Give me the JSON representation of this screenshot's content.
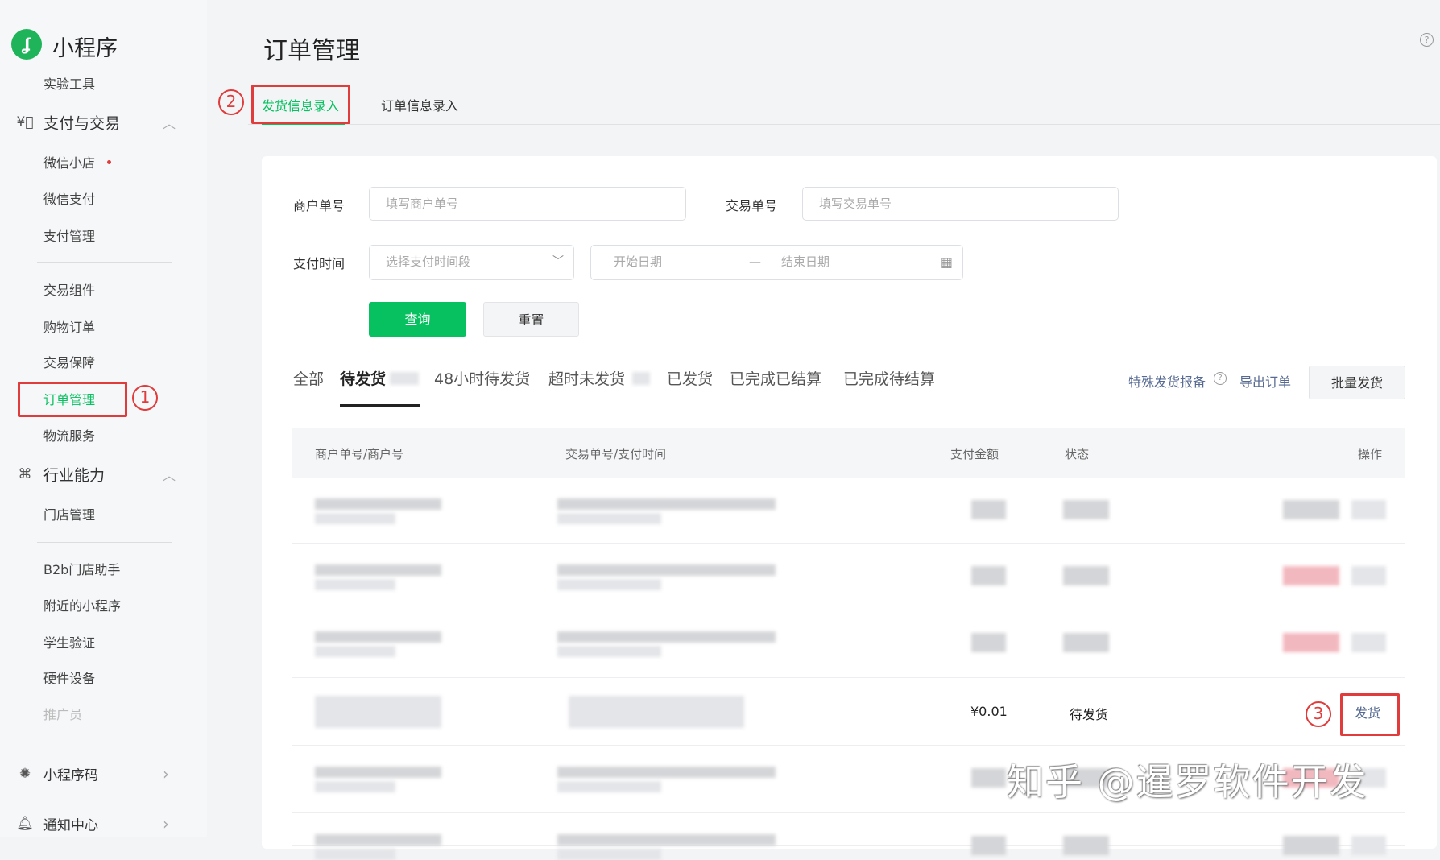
{
  "app": {
    "name": "小程序",
    "help_icon": "question-circle-icon"
  },
  "sidebar": {
    "top_item": "实验工具",
    "groups": [
      {
        "label": "支付与交易",
        "icon": "yuan-circle-icon"
      },
      {
        "label": "行业能力",
        "icon": "industry-icon"
      },
      {
        "label": "小程序码",
        "icon": "qrcode-sparkle-icon"
      },
      {
        "label": "通知中心",
        "icon": "bell-icon"
      }
    ],
    "pay_items": [
      "微信小店",
      "微信支付",
      "支付管理"
    ],
    "trade_items": [
      "交易组件",
      "购物订单",
      "交易保障",
      "订单管理",
      "物流服务"
    ],
    "industry_items": [
      "门店管理"
    ],
    "other_items": [
      "B2b门店助手",
      "附近的小程序",
      "学生验证",
      "硬件设备",
      "推广员"
    ],
    "active": "订单管理",
    "annotation_1": "1"
  },
  "page": {
    "title": "订单管理"
  },
  "tabs": [
    {
      "label": "发货信息录入",
      "active": true
    },
    {
      "label": "订单信息录入"
    }
  ],
  "annotation_2": "2",
  "form": {
    "merchant_no_label": "商户单号",
    "merchant_no_placeholder": "填写商户单号",
    "trade_no_label": "交易单号",
    "trade_no_placeholder": "填写交易单号",
    "pay_time_label": "支付时间",
    "pay_time_select": "选择支付时间段",
    "start_date": "开始日期",
    "date_sep": "—",
    "end_date": "结束日期",
    "query": "查询",
    "reset": "重置"
  },
  "status_tabs": [
    "全部",
    "待发货",
    "48小时待发货",
    "超时未发货",
    "已发货",
    "已完成已结算",
    "已完成待结算"
  ],
  "actions": {
    "special": "特殊发货报备",
    "export": "导出订单",
    "batch": "批量发货"
  },
  "table": {
    "headers": [
      "商户单号/商户号",
      "交易单号/支付时间",
      "支付金额",
      "状态",
      "操作"
    ],
    "visible_row": {
      "amount": "¥0.01",
      "status": "待发货",
      "action": "发货"
    }
  },
  "annotation_3": "3",
  "watermark": "知乎 @暹罗软件开发",
  "colors": {
    "accent": "#07c160",
    "annotation": "#e03c3c"
  }
}
